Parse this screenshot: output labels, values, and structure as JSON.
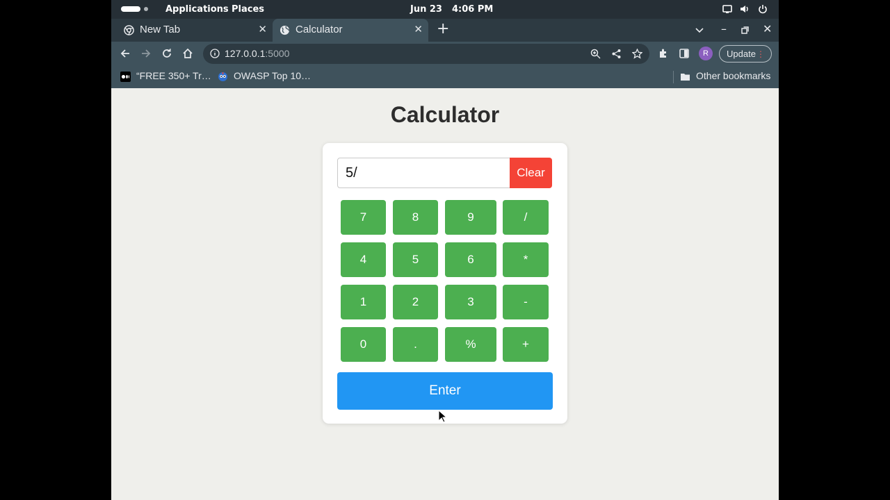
{
  "gnome": {
    "applications": "Applications",
    "places": "Places",
    "date": "Jun 23",
    "time": "4:06 PM"
  },
  "tabs": [
    {
      "title": "New Tab",
      "icon": "chrome-icon"
    },
    {
      "title": "Calculator",
      "icon": "globe-icon",
      "active": true
    }
  ],
  "toolbar": {
    "url_host": "127.0.0.1",
    "url_port": ":5000",
    "profile_initial": "R",
    "update_label": "Update"
  },
  "bookmarks": [
    {
      "label": "“FREE 350+ Tr…",
      "icon": "medium-icon"
    },
    {
      "label": "OWASP Top 10…",
      "icon": "owasp-icon"
    }
  ],
  "other_bookmarks": "Other bookmarks",
  "calculator": {
    "title": "Calculator",
    "display": "5/",
    "clear_label": "Clear",
    "enter_label": "Enter",
    "keys": [
      [
        "7",
        "8",
        "9",
        "/"
      ],
      [
        "4",
        "5",
        "6",
        "*"
      ],
      [
        "1",
        "2",
        "3",
        "-"
      ],
      [
        "0",
        ".",
        "%",
        "+"
      ]
    ]
  },
  "colors": {
    "digit_key": "#4caf50",
    "clear": "#f44336",
    "enter": "#2196f3",
    "page_bg": "#efefeb"
  }
}
